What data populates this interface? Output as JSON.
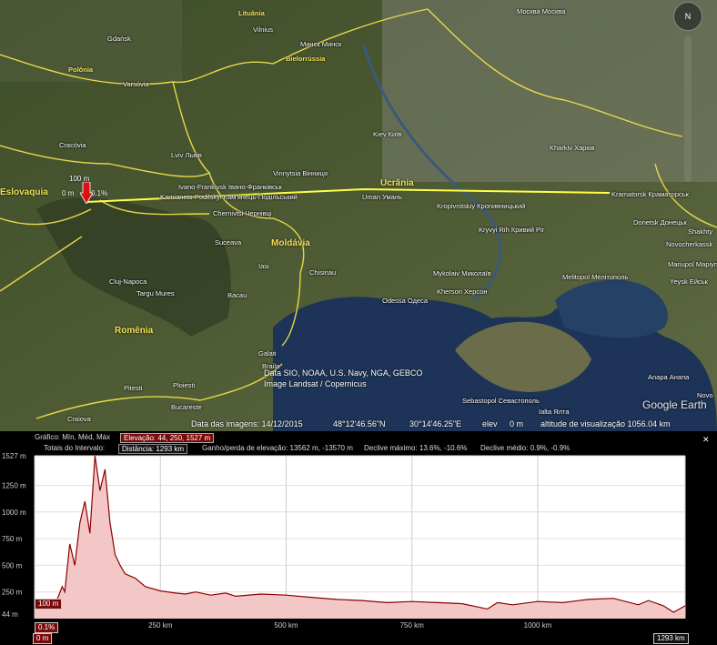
{
  "map": {
    "countries": [
      {
        "id": "lituania",
        "label": "Lituânia"
      },
      {
        "id": "polonia",
        "label": "Polônia"
      },
      {
        "id": "bielorussia",
        "label": "Bielorrússia"
      },
      {
        "id": "ucrania",
        "label": "Ucrânia"
      },
      {
        "id": "moldavia",
        "label": "Moldávia"
      },
      {
        "id": "romenia",
        "label": "Romênia"
      },
      {
        "id": "eslovaquia",
        "label": "Eslovaquia"
      }
    ],
    "places": [
      {
        "id": "gdansk",
        "label": "Gdańsk"
      },
      {
        "id": "vilnius",
        "label": "Vilnius"
      },
      {
        "id": "minsk",
        "label": "Минск Минск"
      },
      {
        "id": "varsovia",
        "label": "Varsóvia"
      },
      {
        "id": "kiev",
        "label": "Kiev Київ"
      },
      {
        "id": "kharkiv",
        "label": "Kharkiv Харків"
      },
      {
        "id": "cracovia",
        "label": "Cracóvia"
      },
      {
        "id": "lviv",
        "label": "Lviv Львів"
      },
      {
        "id": "ivano",
        "label": "Ivano-Frankivsk Івано-Франківськ"
      },
      {
        "id": "vinnytsia",
        "label": "Vinnytsia Вінниця"
      },
      {
        "id": "kamianets",
        "label": "Kamianets-Podilskyi Кам'янець-Подільський"
      },
      {
        "id": "uman",
        "label": "Uman Умань"
      },
      {
        "id": "kramatorsk",
        "label": "Kramatorsk Краматорськ"
      },
      {
        "id": "kropyvnytskyi",
        "label": "Kropivnitskiy Кропивницький"
      },
      {
        "id": "chernivtsi",
        "label": "Chernivtsi Чернівці"
      },
      {
        "id": "donetsk",
        "label": "Donetsk Донецьк"
      },
      {
        "id": "shakhty",
        "label": "Shakhty"
      },
      {
        "id": "kryvyi",
        "label": "Kryvyi Rih Кривий Ріг"
      },
      {
        "id": "novocherkassk",
        "label": "Novocherkassk"
      },
      {
        "id": "suceava",
        "label": "Suceava"
      },
      {
        "id": "iasi",
        "label": "Iasi"
      },
      {
        "id": "chisinau",
        "label": "Chisinau"
      },
      {
        "id": "mykolaiv",
        "label": "Mykolaiv Миколаїв"
      },
      {
        "id": "melitopol",
        "label": "Melitopol Мелітополь"
      },
      {
        "id": "mariupol",
        "label": "Mariupol Маріуполь"
      },
      {
        "id": "cluj",
        "label": "Cluj-Napoca"
      },
      {
        "id": "targu",
        "label": "Targu Mures"
      },
      {
        "id": "bacau",
        "label": "Bacau"
      },
      {
        "id": "odessa",
        "label": "Odessa Одеса"
      },
      {
        "id": "kherson",
        "label": "Kherson Херсон"
      },
      {
        "id": "yeysk",
        "label": "Yeysk Ейськ"
      },
      {
        "id": "galati",
        "label": "Galati"
      },
      {
        "id": "braila",
        "label": "Braila"
      },
      {
        "id": "pitesti",
        "label": "Pitesti"
      },
      {
        "id": "ploiesti",
        "label": "Ploiesti"
      },
      {
        "id": "anapa",
        "label": "Anapa Анапа"
      },
      {
        "id": "sebastopol",
        "label": "Sebastopol Севастополь"
      },
      {
        "id": "yalta",
        "label": "Ialta Ялта"
      },
      {
        "id": "craiova",
        "label": "Craiova"
      },
      {
        "id": "bucareste",
        "label": "Bucareste"
      },
      {
        "id": "novo",
        "label": "Novo"
      },
      {
        "id": "moscow",
        "label": "Москва Москва"
      }
    ],
    "route_labels": {
      "elev": "100 m",
      "zero": "0 m",
      "slope": "0.1%"
    },
    "credits": [
      "Data SIO, NOAA, U.S. Navy, NGA, GEBCO",
      "Image Landsat / Copernicus"
    ],
    "logo": "Google Earth",
    "compass": "N",
    "status": {
      "date_label": "Data das imagens: 14/12/2015",
      "lat": "48°12'46.56\"N",
      "lon": "30°14'46.25\"E",
      "elev_label": "elev",
      "elev_value": "0 m",
      "eye_alt": "altitude de visualização 1056.04 km"
    }
  },
  "profile": {
    "graph_label": "Gráfico: Mín, Méd, Máx",
    "elevation_label": "Elevação: 44, 250, 1527 m",
    "totals_label": "Totais do Intervalo:",
    "distance": "Distância: 1293 km",
    "gain": "Ganho/perda de elevação: 13562 m, -13570 m",
    "max_slope": "Declive máximo: 13.6%, -10.6%",
    "avg_slope": "Declive médio: 0.9%, -0.9%",
    "close": "✕",
    "tag_elev": "100 m",
    "tag_slope": "0.1%",
    "tag_zero": "0 m",
    "tag_end": "1293 km",
    "colors": {
      "line": "#8b0000",
      "fill": "#f4c7c7",
      "bg": "#ffffff"
    }
  },
  "chart_data": {
    "type": "area",
    "xlabel": "",
    "ylabel": "",
    "xlim": [
      0,
      1293
    ],
    "ylim": [
      0,
      1527
    ],
    "x_ticks": [
      "0 m",
      "250 km",
      "500 km",
      "750 km",
      "1000 km",
      "1293 km"
    ],
    "y_ticks": [
      "1527 m",
      "1250 m",
      "1000 m",
      "750 m",
      "500 m",
      "250 m",
      "44 m"
    ],
    "series": [
      {
        "x": [
          0,
          20,
          40,
          55,
          60,
          70,
          80,
          90,
          100,
          110,
          120,
          130,
          140,
          150,
          160,
          170,
          180,
          200,
          220,
          250,
          280,
          300,
          320,
          350,
          380,
          400,
          450,
          500,
          550,
          600,
          650,
          700,
          750,
          800,
          850,
          900,
          920,
          950,
          1000,
          1050,
          1100,
          1150,
          1200,
          1220,
          1250,
          1270,
          1293
        ],
        "values": [
          100,
          90,
          120,
          300,
          250,
          700,
          500,
          900,
          1100,
          800,
          1527,
          1200,
          1400,
          900,
          600,
          500,
          420,
          380,
          300,
          260,
          240,
          230,
          250,
          220,
          240,
          210,
          230,
          220,
          200,
          180,
          170,
          150,
          160,
          150,
          140,
          90,
          150,
          130,
          160,
          150,
          180,
          190,
          130,
          170,
          120,
          60,
          120
        ]
      }
    ]
  }
}
